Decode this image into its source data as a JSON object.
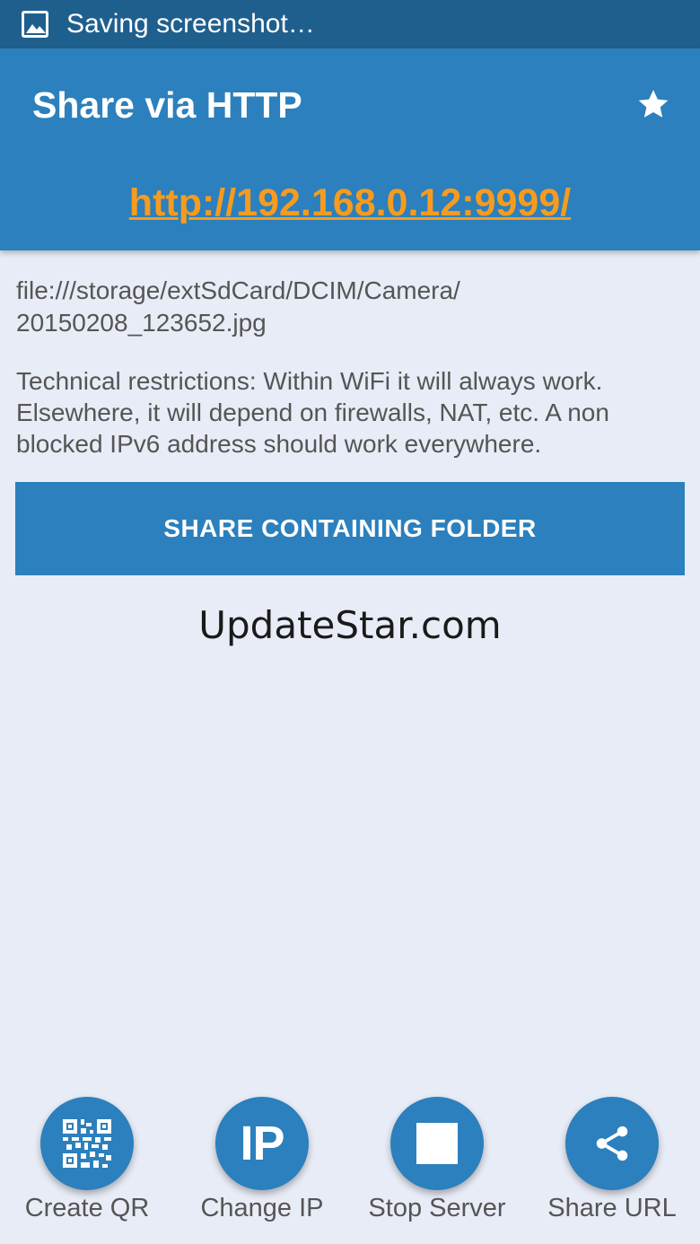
{
  "status_bar": {
    "icon": "image-icon",
    "text": "Saving screenshot…"
  },
  "app_bar": {
    "title": "Share via HTTP",
    "star_icon": "star-icon",
    "url": "http://192.168.0.12:9999/"
  },
  "content": {
    "file_path": "file:///storage/extSdCard/DCIM/Camera/\n20150208_123652.jpg",
    "restrictions": "Technical restrictions: Within WiFi it will always work. Elsewhere, it will depend on firewalls, NAT, etc. A non blocked IPv6 address should work everywhere.",
    "share_folder_label": "SHARE CONTAINING FOLDER",
    "watermark": "UpdateStar.com"
  },
  "actions": [
    {
      "label": "Create QR",
      "icon": "qr-code-icon"
    },
    {
      "label": "Change IP",
      "icon": "ip-icon",
      "icon_text": "IP"
    },
    {
      "label": "Stop Server",
      "icon": "stop-icon"
    },
    {
      "label": "Share URL",
      "icon": "share-icon"
    }
  ],
  "colors": {
    "status_bar": "#1f5f8e",
    "primary": "#2b80bd",
    "link": "#f79b1e",
    "background": "#e8ecf6"
  }
}
